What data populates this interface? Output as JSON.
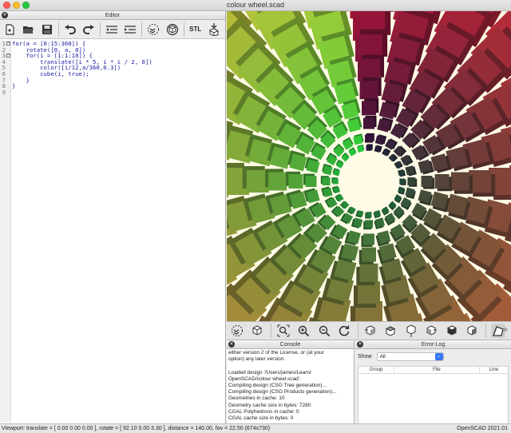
{
  "window": {
    "title": "colour wheel.scad"
  },
  "editor": {
    "title": "Editor",
    "toolbar": [
      "new-icon",
      "open-icon",
      "save-icon",
      "undo-icon",
      "redo-icon",
      "unindent-icon",
      "indent-icon",
      "preview-icon",
      "render-icon",
      "export-stl-icon",
      "send-to-print-icon"
    ],
    "stl_label": "STL",
    "lines": [
      {
        "n": "1",
        "fold": true,
        "text": "for(a = [0:15:360]) {"
      },
      {
        "n": "2",
        "fold": false,
        "text": "    rotate([0, a, 0])"
      },
      {
        "n": "3",
        "fold": true,
        "text": "    for(i = [1:1:10]) {"
      },
      {
        "n": "4",
        "fold": false,
        "text": "        translate([i * 5, i * i / 2, 0])"
      },
      {
        "n": "5",
        "fold": false,
        "text": "        color([i/12,a/360,0.3])"
      },
      {
        "n": "6",
        "fold": false,
        "text": "        cube(i, true);"
      },
      {
        "n": "7",
        "fold": false,
        "text": "    }"
      },
      {
        "n": "8",
        "fold": false,
        "text": "}"
      },
      {
        "n": "9",
        "fold": false,
        "text": ""
      }
    ]
  },
  "view_toolbar": [
    "view-all-icon",
    "reset-view-icon",
    "zoom-all-icon",
    "zoom-in-icon",
    "zoom-out-icon",
    "reset-rotation-icon",
    "view-right-icon",
    "view-top-icon",
    "view-bottom-icon",
    "view-left-icon",
    "view-front-icon",
    "view-back-icon",
    "perspective-icon",
    "more-icon"
  ],
  "console": {
    "title": "Console",
    "lines": [
      "either version 2 of the License, or (at your",
      "option) any later version.",
      "",
      "Loaded design '/Users/james/Learn/",
      "OpenSCAD/colour wheel.scad'.",
      "Compiling design (CSG Tree generation)...",
      "Compiling design (CSG Products generation)...",
      "Geometries in cache: 10",
      "Geometry cache size in bytes: 7280",
      "CGAL Polyhedrons in cache: 0",
      "CGAL cache size in bytes: 0"
    ]
  },
  "error_log": {
    "title": "Error-Log",
    "show_label": "Show",
    "show_value": "All",
    "columns": [
      "Group",
      "File",
      "Line"
    ]
  },
  "status": {
    "viewport": "Viewport: translate = [ 0.00 0.00 0.00 ], rotate = [ 92.10 0.00 3.30 ], distance = 140.00, fov = 22.50 (674x730)",
    "version": "OpenSCAD 2021.01"
  },
  "colors": {
    "background": "#fffbe6",
    "code_text": "#1a1aa6",
    "accent": "#3478f6"
  }
}
